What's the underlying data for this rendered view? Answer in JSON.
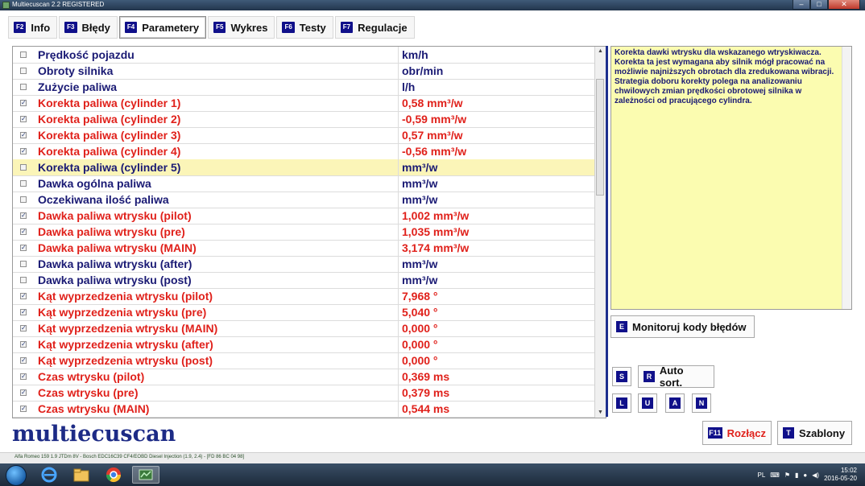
{
  "window": {
    "title": "Multiecuscan 2.2 REGISTERED",
    "controls": [
      "–",
      "□",
      "✕"
    ]
  },
  "tabs": [
    {
      "key": "F2",
      "label": "Info",
      "active": false
    },
    {
      "key": "F3",
      "label": "Błędy",
      "active": false
    },
    {
      "key": "F4",
      "label": "Parametery",
      "active": true
    },
    {
      "key": "F5",
      "label": "Wykres",
      "active": false
    },
    {
      "key": "F6",
      "label": "Testy",
      "active": false
    },
    {
      "key": "F7",
      "label": "Regulacje",
      "active": false
    }
  ],
  "params": [
    {
      "name": "Prędkość pojazdu",
      "value": "km/h",
      "checked": false
    },
    {
      "name": "Obroty silnika",
      "value": "obr/min",
      "checked": false
    },
    {
      "name": "Zużycie paliwa",
      "value": "l/h",
      "checked": false
    },
    {
      "name": "Korekta paliwa (cylinder 1)",
      "value": "0,58 mm³/w",
      "checked": true
    },
    {
      "name": "Korekta paliwa (cylinder 2)",
      "value": "-0,59 mm³/w",
      "checked": true
    },
    {
      "name": "Korekta paliwa (cylinder 3)",
      "value": "0,57 mm³/w",
      "checked": true
    },
    {
      "name": "Korekta paliwa (cylinder 4)",
      "value": "-0,56 mm³/w",
      "checked": true
    },
    {
      "name": "Korekta paliwa (cylinder 5)",
      "value": "mm³/w",
      "checked": false,
      "highlighted": true
    },
    {
      "name": "Dawka ogólna paliwa",
      "value": "mm³/w",
      "checked": false
    },
    {
      "name": "Oczekiwana ilość paliwa",
      "value": "mm³/w",
      "checked": false
    },
    {
      "name": "Dawka paliwa wtrysku (pilot)",
      "value": "1,002 mm³/w",
      "checked": true
    },
    {
      "name": "Dawka paliwa wtrysku (pre)",
      "value": "1,035 mm³/w",
      "checked": true
    },
    {
      "name": "Dawka paliwa wtrysku (MAIN)",
      "value": "3,174 mm³/w",
      "checked": true
    },
    {
      "name": "Dawka paliwa wtrysku (after)",
      "value": "mm³/w",
      "checked": false
    },
    {
      "name": "Dawka paliwa wtrysku (post)",
      "value": "mm³/w",
      "checked": false
    },
    {
      "name": "Kąt wyprzedzenia wtrysku (pilot)",
      "value": "7,968 °",
      "checked": true
    },
    {
      "name": "Kąt wyprzedzenia wtrysku (pre)",
      "value": "5,040 °",
      "checked": true
    },
    {
      "name": "Kąt wyprzedzenia wtrysku (MAIN)",
      "value": "0,000 °",
      "checked": true
    },
    {
      "name": "Kąt wyprzedzenia wtrysku (after)",
      "value": "0,000 °",
      "checked": true
    },
    {
      "name": "Kąt wyprzedzenia wtrysku (post)",
      "value": "0,000 °",
      "checked": true
    },
    {
      "name": "Czas wtrysku (pilot)",
      "value": "0,369 ms",
      "checked": true
    },
    {
      "name": "Czas wtrysku (pre)",
      "value": "0,379 ms",
      "checked": true
    },
    {
      "name": "Czas wtrysku (MAIN)",
      "value": "0,544 ms",
      "checked": true
    }
  ],
  "description": {
    "text": "Korekta dawki wtrysku dla wskazanego wtryskiwacza. Korekta ta jest wymagana aby silnik mógł pracować na możliwie najniższych obrotach dla zredukowana wibracji.\nStrategia doboru korekty polega na analizowaniu chwilowych zmian prędkości obrotowej silnika w zależności od pracującego cylindra."
  },
  "buttons": {
    "monitor": {
      "key": "E",
      "label": "Monitoruj kody błędów"
    },
    "s": {
      "key": "S"
    },
    "autosort": {
      "key": "R",
      "label": "Auto sort."
    },
    "l": {
      "key": "L"
    },
    "u": {
      "key": "U"
    },
    "a": {
      "key": "A"
    },
    "n": {
      "key": "N"
    },
    "disconnect": {
      "key": "F11",
      "label": "Rozłącz"
    },
    "templates": {
      "key": "T",
      "label": "Szablony"
    }
  },
  "logo": "multiecuscan",
  "status": "Alfa Romeo 159 1.9 JTDm 8V - Bosch EDC16C39 CF4/EOBD Diesel Injection (1.9, 2.4) - [FD 86 BC 04 98]",
  "taskbar": {
    "language": "PL",
    "time": "15:02",
    "date": "2016-05-20"
  },
  "colors": {
    "selected_text": "#e0211b",
    "unselected_text": "#1a1a74",
    "highlight_row": "#fbf5b8",
    "description_bg": "#fbfcb0",
    "accent": "#10108a"
  }
}
